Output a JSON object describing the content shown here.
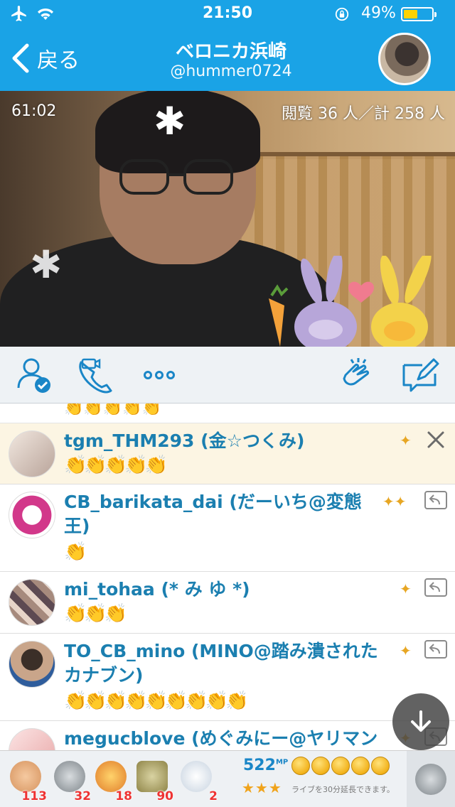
{
  "status_bar": {
    "time": "21:50",
    "battery_percent": "49%",
    "battery_level": 0.49
  },
  "header": {
    "back_label": "戻る",
    "title": "ベロニカ浜崎",
    "handle": "@hummer0724"
  },
  "video": {
    "elapsed": "61:02",
    "viewers": "閲覧 36 人／計 258 人"
  },
  "action_bar": {
    "icons": [
      "follow-check-icon",
      "video-call-icon",
      "more-icon",
      "clap-icon",
      "compose-icon"
    ]
  },
  "comments": {
    "peek_text": "👏👏👏👏👏",
    "items": [
      {
        "user": "tgm_THM293 (金☆つくみ)",
        "message": "👏👏👏👏👏",
        "highlight": true,
        "action_icon": "close-icon",
        "medals": 1
      },
      {
        "user": "CB_barikata_dai (だーいち@変態王)",
        "message": "👏",
        "highlight": false,
        "action_icon": "reply-icon",
        "medals": 2
      },
      {
        "user": "mi_tohaa (* み ゆ *)",
        "message": "👏👏👏",
        "highlight": false,
        "action_icon": "reply-icon",
        "medals": 1
      },
      {
        "user": "TO_CB_mino (MINO@踏み潰されたカナブン)",
        "message": "👏👏👏👏👏👏👏👏👏",
        "highlight": false,
        "action_icon": "reply-icon",
        "medals": 1
      },
      {
        "user": "megucblove (めぐみにー@ヤリマン",
        "message": "",
        "highlight": false,
        "action_icon": "reply-icon",
        "medals": 1
      }
    ]
  },
  "gift_bar": {
    "gifts": [
      {
        "name": "clap-gift-icon",
        "count": "113"
      },
      {
        "name": "coin-gift-icon",
        "count": "32"
      },
      {
        "name": "cracker-gift-icon",
        "count": "18"
      },
      {
        "name": "tea-gift-icon",
        "count": "90"
      },
      {
        "name": "bear-gift-icon",
        "count": "2"
      }
    ],
    "mp_value": "522",
    "mp_unit": "MP",
    "star_rating": "★★★",
    "coin_count": 5,
    "extend_text": "ライブを30分延長できます。"
  }
}
